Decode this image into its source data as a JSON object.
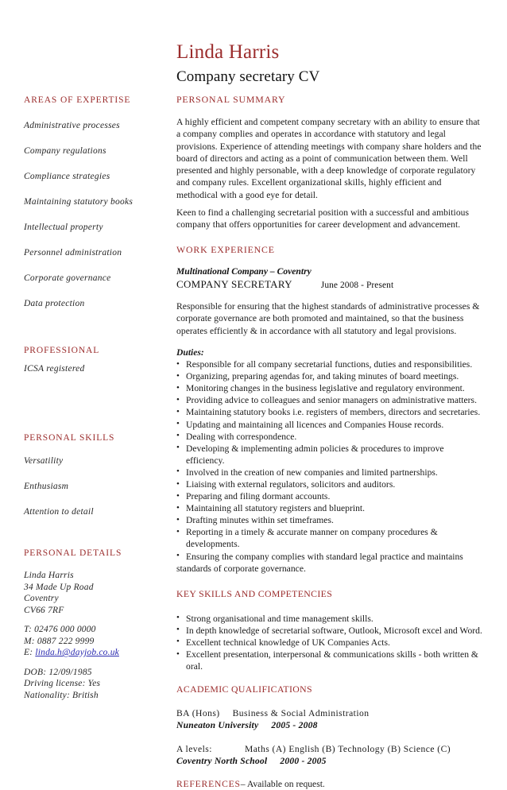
{
  "header": {
    "name": "Linda Harris",
    "subtitle": "Company secretary CV",
    "name_color": "#9b2d2d"
  },
  "sidebar": {
    "expertise": {
      "heading": "AREAS OF EXPERTISE",
      "items": [
        "Administrative processes",
        "Company regulations",
        "Compliance strategies",
        "Maintaining statutory books",
        "Intellectual property",
        "Personnel administration",
        "Corporate governance",
        "Data protection"
      ]
    },
    "professional": {
      "heading": "PROFESSIONAL",
      "items": [
        "ICSA registered"
      ]
    },
    "personal_skills": {
      "heading": "PERSONAL SKILLS",
      "items": [
        "Versatility",
        "Enthusiasm",
        "Attention to detail"
      ]
    },
    "personal_details": {
      "heading": "PERSONAL DETAILS",
      "address": [
        "Linda Harris",
        "34 Made Up Road",
        "Coventry",
        "CV66 7RF"
      ],
      "contact": {
        "tel": "T: 02476 000 0000",
        "mobile": "M: 0887 222 9999",
        "email_label": "E:",
        "email": "linda.h@dayjob.co.uk",
        "email_color": "#2a2ab0"
      },
      "facts": [
        "DOB: 12/09/1985",
        "Driving license:  Yes",
        "Nationality: British"
      ]
    }
  },
  "main": {
    "personal_summary": {
      "heading": "PERSONAL SUMMARY",
      "paragraphs": [
        "A highly efficient and competent company secretary with an ability to ensure that a company complies and operates in accordance with statutory and legal provisions. Experience of attending meetings with company share holders and the board of directors and acting as a point of communication between them. Well presented and highly personable, with a deep knowledge of corporate regulatory and company rules. Excellent organizational skills, highly efficient and methodical with a good eye for detail.",
        "Keen to find a challenging secretarial position with a successful and ambitious company that offers opportunities for career development and advancement."
      ]
    },
    "work_experience": {
      "heading": "WORK EXPERIENCE",
      "employer": "Multinational Company – Coventry",
      "role": "COMPANY SECRETARY",
      "dates": "June 2008 - Present",
      "summary": "Responsible for ensuring that the highest standards of administrative processes & corporate governance are both promoted and maintained, so that the business operates efficiently & in accordance with all statutory and legal provisions.",
      "duties_label": "Duties:",
      "duties": [
        "Responsible for all company secretarial functions, duties and responsibilities.",
        "Organizing, preparing agendas for, and taking minutes of board meetings.",
        "Monitoring changes in the business legislative and regulatory environment.",
        "Providing advice to colleagues and senior managers on administrative matters.",
        "Maintaining statutory books i.e. registers of members, directors and secretaries.",
        "Updating and maintaining all licences and Companies House records.",
        "Dealing with correspondence.",
        "Developing & implementing admin policies & procedures to improve efficiency.",
        "Involved in the creation of new companies and limited partnerships.",
        "Liaising with external regulators, solicitors and auditors.",
        "Preparing and filing dormant accounts.",
        "Maintaining all statutory registers and blueprint.",
        "Drafting minutes within set timeframes.",
        "Reporting in a timely & accurate manner on company procedures & developments."
      ],
      "duty_last_line1": "Ensuring the company complies with standard legal practice and maintains",
      "duty_last_line2": "standards of corporate governance."
    },
    "key_skills": {
      "heading": "KEY SKILLS AND COMPETENCIES",
      "items": [
        "Strong organisational and time management skills.",
        "In depth knowledge of secretarial software, Outlook, Microsoft excel and Word.",
        "Excellent technical knowledge of UK Companies Acts.",
        "Excellent presentation, interpersonal & communications skills - both written & oral."
      ]
    },
    "academic": {
      "heading": "ACADEMIC QUALIFICATIONS",
      "entries": [
        {
          "qualification": "BA (Hons)",
          "subject": "Business & Social Administration",
          "school": "Nuneaton University",
          "years": "2005 - 2008"
        },
        {
          "qualification": "A levels:",
          "subject": "Maths (A) English (B) Technology (B) Science (C)",
          "school": "Coventry North School",
          "years": "2000 - 2005"
        }
      ]
    },
    "references": {
      "label": "REFERENCES",
      "text": "– Available on request."
    }
  }
}
